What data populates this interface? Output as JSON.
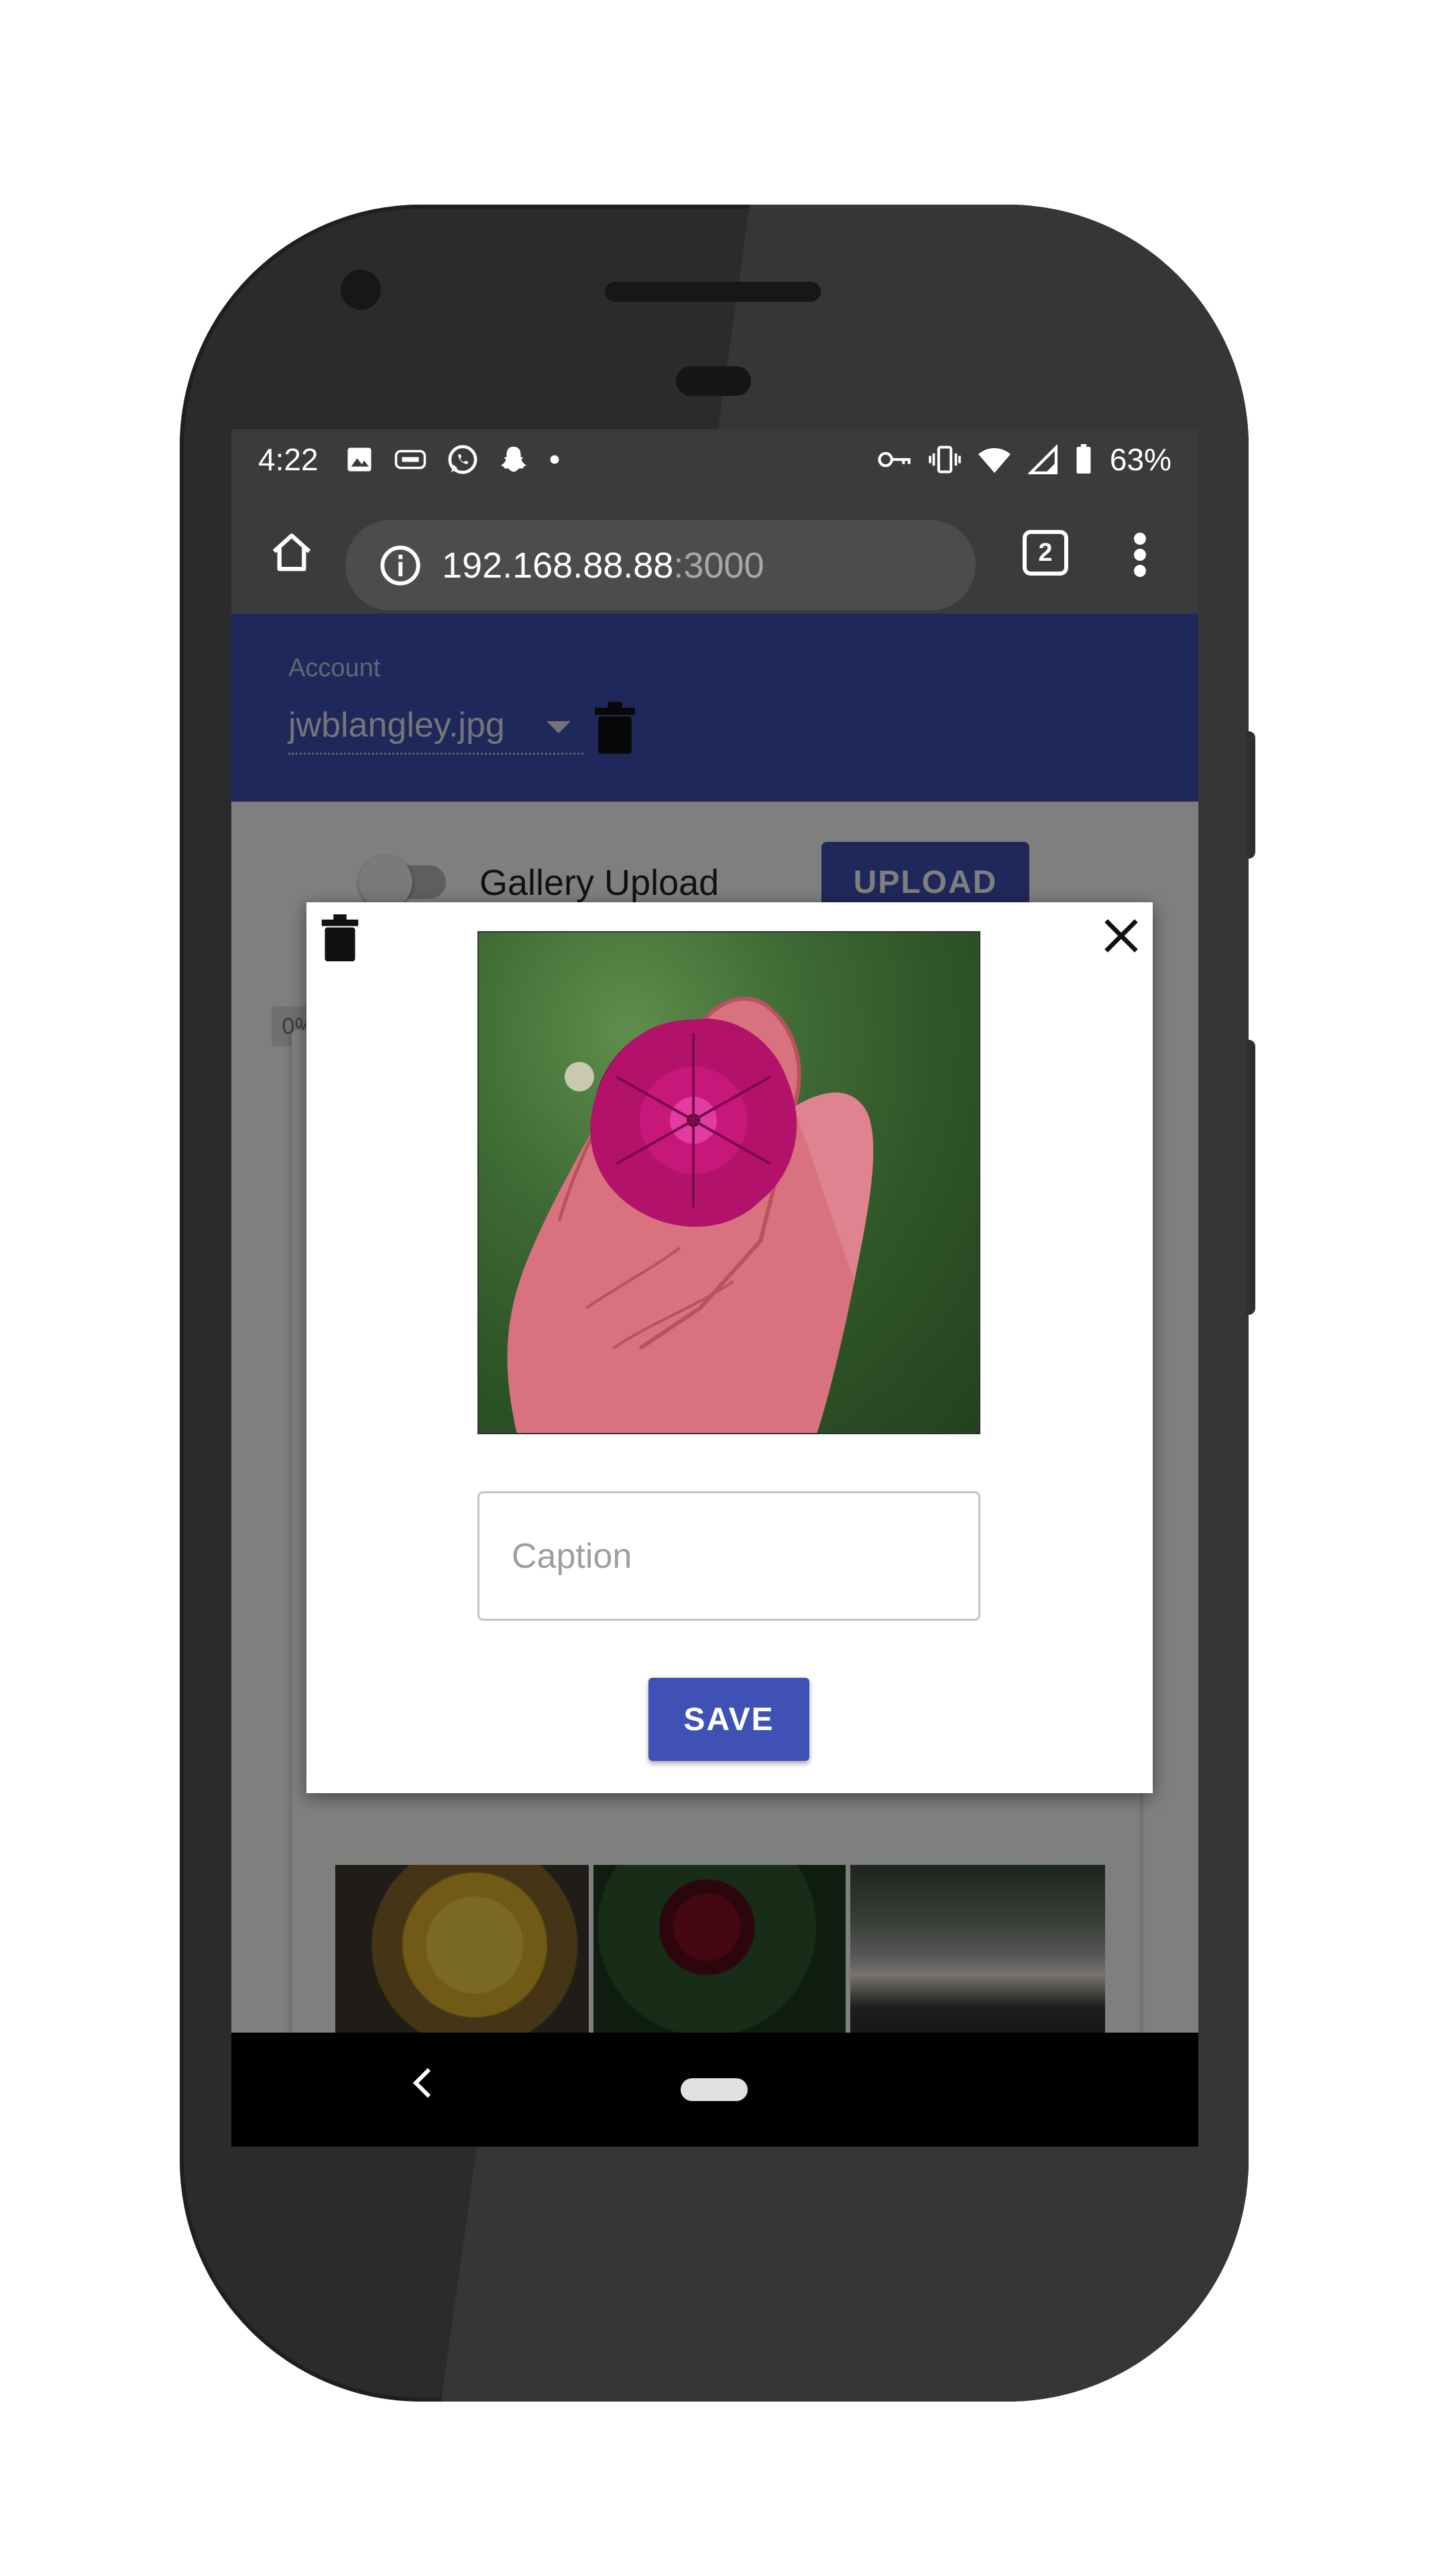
{
  "status_bar": {
    "time": "4:22",
    "battery": "63%",
    "left_icons": [
      "image-icon",
      "cast-icon",
      "whatsapp-icon",
      "snapchat-icon",
      "dot-icon"
    ],
    "right_icons": [
      "key-icon",
      "vibrate-icon",
      "wifi-icon",
      "signal-icon",
      "battery-icon"
    ]
  },
  "browser": {
    "url_host": "192.168.88.88",
    "url_port": ":3000",
    "tab_count": "2"
  },
  "app": {
    "account_label": "Account",
    "account_value": "jwblangley.jpg",
    "gallery_upload_label": "Gallery Upload",
    "upload_label": "UPLOAD",
    "progress_label": "0%"
  },
  "dialog": {
    "caption_placeholder": "Caption",
    "caption_value": "",
    "save_label": "SAVE"
  },
  "colors": {
    "primary": "#3f51b5",
    "status_bar": "#3a3b3c",
    "scrim": "rgba(0,0,0,0.5)"
  }
}
